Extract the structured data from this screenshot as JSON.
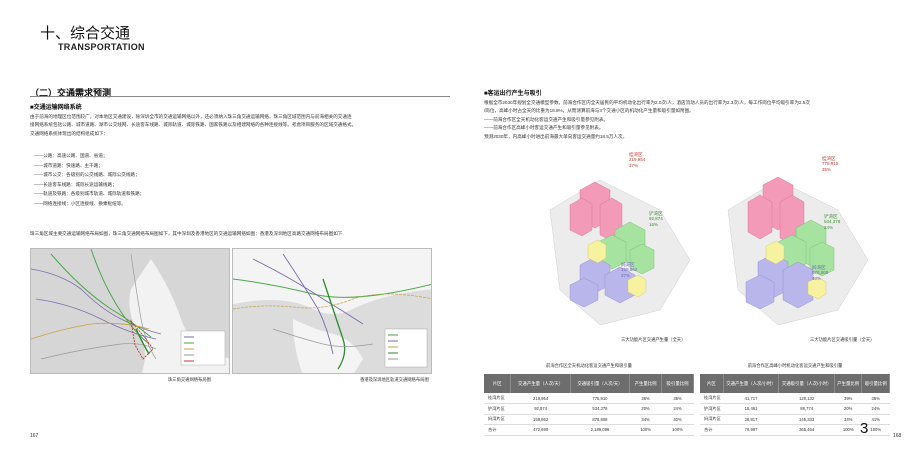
{
  "section": {
    "title": "十、综合交通",
    "subtitle": "TRANSPORTATION"
  },
  "left": {
    "heading": "（二）交通需求预测",
    "subheading": "■交通运输网络系统",
    "intro": [
      "由于前海的地理区位范围较广，对本地区交通建设，除深圳全市的交通运输网络以外，还必须纳入珠三角交通运输网络，珠三角区域范围内与前海相关的交通连",
      "接网络系统包括公路、城市道路、湖市公交线网、长途客车线路、城际轨道、城际铁路、国家铁路以及相建网络的各种连接线等。考虑项目服务的区域交通格式。",
      "交通网络系统体现出的结构组成如下："
    ],
    "list": [
      "——公路：高速公路、国道、省道；",
      "——城市道路：快速路、主干路；",
      "——城市公交：各级别的公交线路、城际公交线路；",
      "——长途客车线路：城际长途运输线路；",
      "——轨道及铁路：各级别城市轨道、城际轨道和铁路；",
      "——网络连接线：小区连接线、换乘枢纽等。"
    ],
    "map_intro": "珠三角区域主要交通运输网络布局如图，珠三角交通网络布局图如下，其中深圳及香港地区的交通运输网络如图：香港及深圳地区高路交通网络布局图如下",
    "map_left_caption": "珠三角交通网络布局图",
    "map_right_caption": "香港及深圳地区轨道交通网络布局图",
    "page_number": "167"
  },
  "right": {
    "subheading": "■客运出行产生与吸引",
    "paragraphs": [
      "根据全市2030年规划全交通模型参数，前海合作区内全天居民的平均机动化出行率为2.0次/人，酒店流动人员的出行率为2.3次/人，每工作岗位平均吸引率为2.5次",
      "/岗位，高峰小时占全天的比重为18.8%，从而测算前海与3个交通小区的机动化产生量和吸引量如附图。",
      "——前海合作区全天机动化客运交通产生和吸引量参见附表。",
      "——前海合作区高峰小时客运交通产生和吸引量参见附表。",
      "预测2030年，内高峰小时进出前海最大单向客运交通量约18.5万人次。"
    ],
    "map_left": {
      "caption": "三大功能片区交通产生量（全天）",
      "districts": [
        {
          "name": "桂湾区",
          "value": "219,954",
          "pct": "37%"
        },
        {
          "name": "铲湾区",
          "value": "92,874",
          "pct": "16%"
        },
        {
          "name": "妈湾区",
          "value": "159,862",
          "pct": "27%"
        }
      ]
    },
    "map_right": {
      "caption": "三大功能片区交通吸引量（全天）",
      "districts": [
        {
          "name": "桂湾区",
          "value": "775,910",
          "pct": "35%"
        },
        {
          "name": "铲湾区",
          "value": "534,378",
          "pct": "24%"
        },
        {
          "name": "妈湾区",
          "value": "878,808",
          "pct": "40%"
        }
      ]
    },
    "table_left": {
      "caption": "前海合作区全天机动化客运交通产生和吸引量",
      "headers": [
        "片区",
        "交通产生量（人次/天）",
        "交通吸引量（人次/天）",
        "产生量比例",
        "吸引量比例"
      ],
      "rows": [
        [
          "桂湾片区",
          "219,954",
          "775,910",
          "36%",
          "35%"
        ],
        [
          "铲湾片区",
          "92,874",
          "534,378",
          "20%",
          "24%"
        ],
        [
          "妈湾片区",
          "159,862",
          "878,808",
          "34%",
          "40%"
        ],
        [
          "合计",
          "472,690",
          "2,189,096",
          "100%",
          "100%"
        ]
      ]
    },
    "table_right": {
      "caption": "前海合作区高峰小时机动化客运交通产生和吸引量",
      "headers": [
        "片区",
        "交通产生量（人次/小时）",
        "交通吸引量（人次/小时）",
        "产生量比例",
        "吸引量比例"
      ],
      "rows": [
        [
          "桂湾片区",
          "41,717",
          "120,132",
          "39%",
          "35%"
        ],
        [
          "铲湾片区",
          "15,461",
          "88,774",
          "20%",
          "24%"
        ],
        [
          "妈湾片区",
          "26,817",
          "145,333",
          "34%",
          "41%"
        ],
        [
          "合计",
          "79,997",
          "365,464",
          "100%",
          "100%"
        ]
      ]
    },
    "page_number": "168",
    "big_number": "3"
  },
  "colors": {
    "map_bg": "#d8d8d8",
    "table_header": "#6d6d6d",
    "district_red": "#c0392b",
    "green": "#5cb85c",
    "purple": "#8e6bbf"
  }
}
